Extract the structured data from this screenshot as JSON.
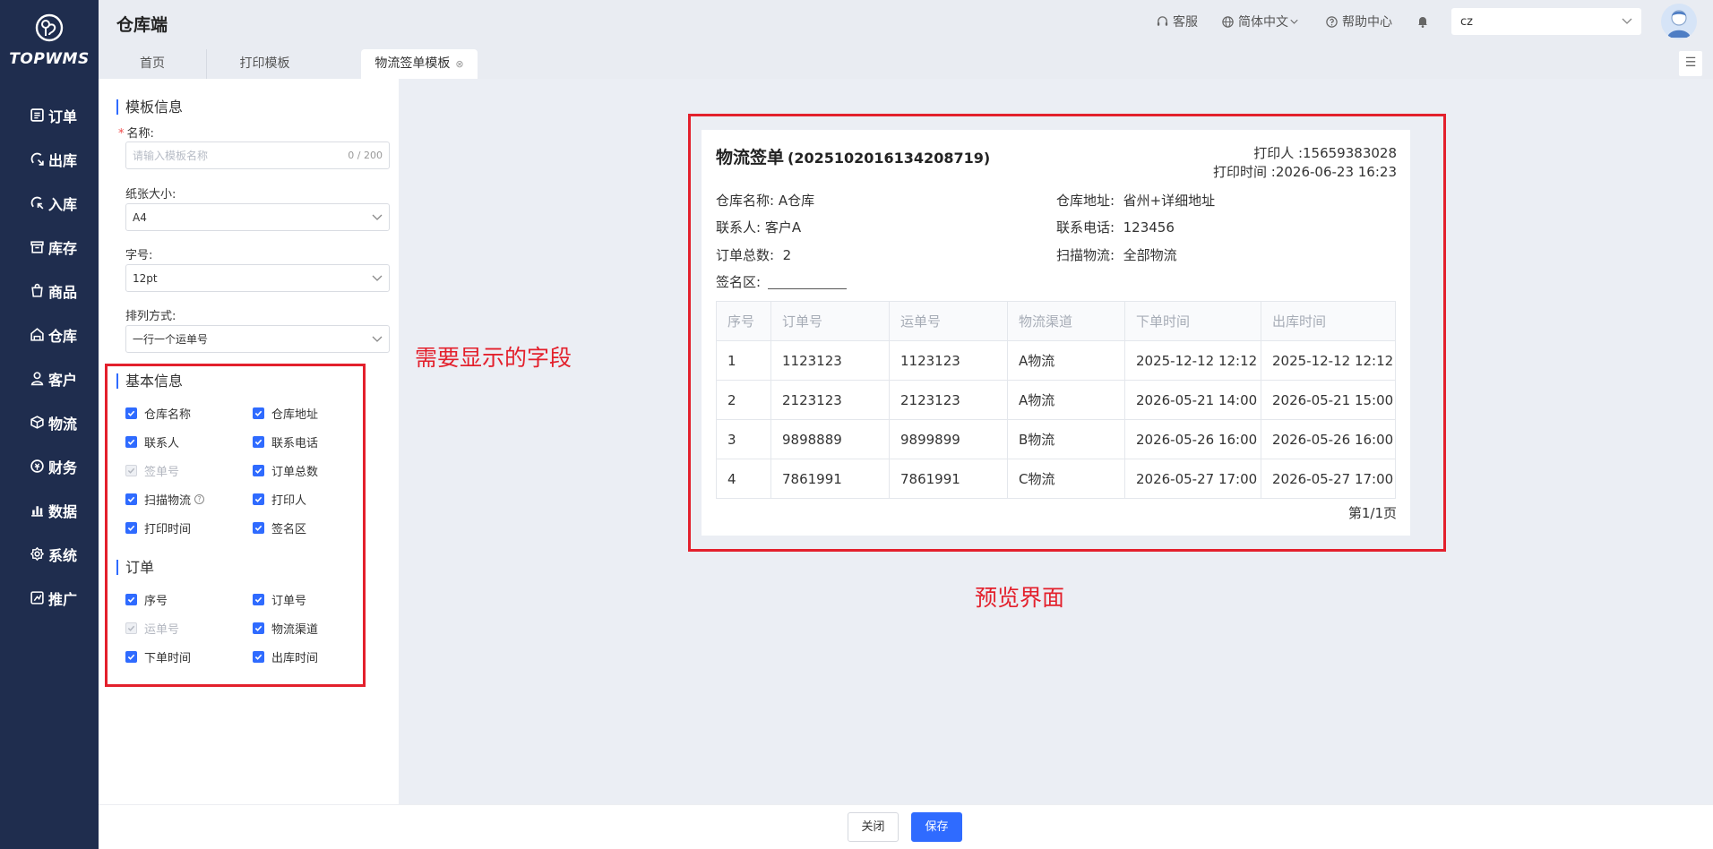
{
  "app": {
    "logo_text": "TOPWMS",
    "header_title": "仓库端"
  },
  "sidebar": {
    "items": [
      {
        "label": "订单",
        "icon": "order-icon"
      },
      {
        "label": "出库",
        "icon": "outbound-icon"
      },
      {
        "label": "入库",
        "icon": "inbound-icon"
      },
      {
        "label": "库存",
        "icon": "inventory-icon"
      },
      {
        "label": "商品",
        "icon": "product-icon"
      },
      {
        "label": "仓库",
        "icon": "warehouse-icon"
      },
      {
        "label": "客户",
        "icon": "customer-icon"
      },
      {
        "label": "物流",
        "icon": "logistics-icon"
      },
      {
        "label": "财务",
        "icon": "finance-icon"
      },
      {
        "label": "数据",
        "icon": "data-icon"
      },
      {
        "label": "系统",
        "icon": "system-icon"
      },
      {
        "label": "推广",
        "icon": "promotion-icon"
      }
    ]
  },
  "header": {
    "service": "客服",
    "language": "简体中文",
    "help": "帮助中心",
    "warehouse_value": "cz"
  },
  "tabs": {
    "home": "首页",
    "print_template": "打印模板",
    "active": "物流签单模板"
  },
  "form": {
    "template_info_title": "模板信息",
    "name_label": "名称:",
    "name_placeholder": "请输入模板名称",
    "name_counter": "0 / 200",
    "paper_label": "纸张大小:",
    "paper_value": "A4",
    "font_label": "字号:",
    "font_value": "12pt",
    "arrange_label": "排列方式:",
    "arrange_value": "一行一个运单号"
  },
  "basic_info": {
    "title": "基本信息",
    "fields": [
      {
        "label": "仓库名称",
        "checked": true,
        "disabled": false
      },
      {
        "label": "仓库地址",
        "checked": true,
        "disabled": false
      },
      {
        "label": "联系人",
        "checked": true,
        "disabled": false
      },
      {
        "label": "联系电话",
        "checked": true,
        "disabled": false
      },
      {
        "label": "签单号",
        "checked": true,
        "disabled": true
      },
      {
        "label": "订单总数",
        "checked": true,
        "disabled": false
      },
      {
        "label": "扫描物流",
        "checked": true,
        "disabled": false
      },
      {
        "label": "打印人",
        "checked": true,
        "disabled": false
      },
      {
        "label": "打印时间",
        "checked": true,
        "disabled": false
      },
      {
        "label": "签名区",
        "checked": true,
        "disabled": false
      }
    ]
  },
  "order_fields": {
    "title": "订单",
    "fields": [
      {
        "label": "序号",
        "checked": true,
        "disabled": false
      },
      {
        "label": "订单号",
        "checked": true,
        "disabled": false
      },
      {
        "label": "运单号",
        "checked": true,
        "disabled": true
      },
      {
        "label": "物流渠道",
        "checked": true,
        "disabled": false
      },
      {
        "label": "下单时间",
        "checked": true,
        "disabled": false
      },
      {
        "label": "出库时间",
        "checked": true,
        "disabled": false
      }
    ]
  },
  "annotations": {
    "fields_note": "需要显示的字段",
    "preview_note": "预览界面"
  },
  "preview": {
    "title": "物流签单",
    "number": "(2025102016134208719)",
    "printer": "打印人 :15659383028",
    "print_time": "打印时间 :2026-06-23 16:23",
    "warehouse_name_label": "仓库名称:",
    "warehouse_name": "A仓库",
    "warehouse_addr_label": "仓库地址:",
    "warehouse_addr": "省州+详细地址",
    "contact_label": "联系人:",
    "contact": "客户A",
    "phone_label": "联系电话:",
    "phone": "123456",
    "order_total_label": "订单总数:",
    "order_total": "2",
    "scan_label": "扫描物流:",
    "scan_value": "全部物流",
    "sign_label": "签名区:",
    "columns": [
      "序号",
      "订单号",
      "运单号",
      "物流渠道",
      "下单时间",
      "出库时间"
    ],
    "rows": [
      [
        "1",
        "1123123",
        "1123123",
        "A物流",
        "2025-12-12 12:12",
        "2025-12-12 12:12"
      ],
      [
        "2",
        "2123123",
        "2123123",
        "A物流",
        "2026-05-21 14:00",
        "2026-05-21 15:00"
      ],
      [
        "3",
        "9898889",
        "9899899",
        "B物流",
        "2026-05-26 16:00",
        "2026-05-26 16:00"
      ],
      [
        "4",
        "7861991",
        "7861991",
        "C物流",
        "2026-05-27 17:00",
        "2026-05-27 17:00"
      ]
    ],
    "page": "第1/1页"
  },
  "footer": {
    "close": "关闭",
    "save": "保存"
  },
  "colors": {
    "sidebar": "#1f2d4e",
    "primary": "#2f6bff",
    "annotation": "#e3202c"
  }
}
